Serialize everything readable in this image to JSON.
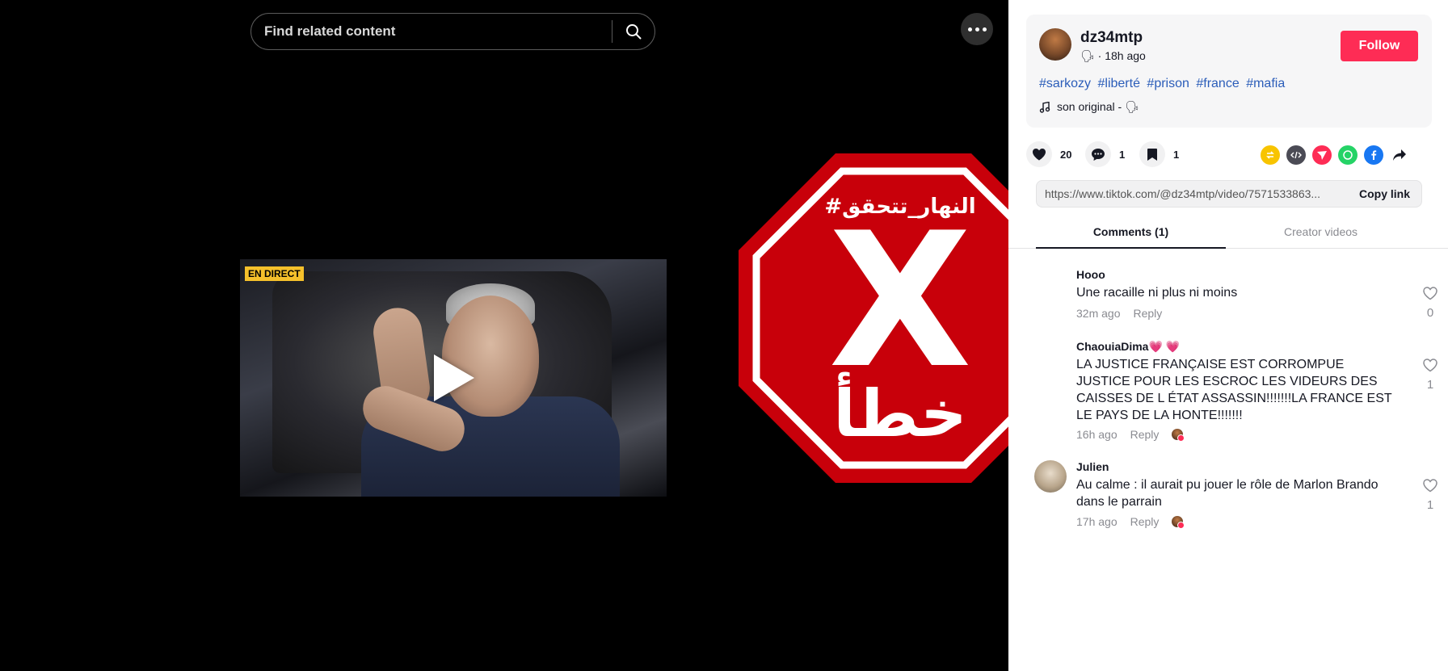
{
  "search": {
    "placeholder": "Find related content"
  },
  "video": {
    "badge": "EN DIRECT"
  },
  "stamp": {
    "hashtag": "#النهار_تتحقق",
    "mark": "X",
    "verdict": "خطأ",
    "color": "#c8000a"
  },
  "author": {
    "username": "dz34mtp",
    "meta": "🗣 · 18h ago",
    "follow_label": "Follow"
  },
  "tags": [
    "#sarkozy",
    "#liberté",
    "#prison",
    "#france",
    "#mafia"
  ],
  "music": {
    "icon": "music-note-icon",
    "label": "son original - 🗣"
  },
  "actions": {
    "likes": "20",
    "comments": "1",
    "saves": "1"
  },
  "link": {
    "url": "https://www.tiktok.com/@dz34mtp/video/7571533863...",
    "copy_label": "Copy link"
  },
  "tabs": [
    {
      "label": "Comments (1)"
    },
    {
      "label": "Creator videos"
    }
  ],
  "comments": [
    {
      "name": "Hooo",
      "text": "Une racaille ni plus ni moins",
      "time": "32m ago",
      "reply": "Reply",
      "likes": "0"
    },
    {
      "name": "ChaouiaDima💗 💗",
      "text": "LA JUSTICE FRANÇAISE EST CORROMPUE JUSTICE POUR LES ESCROC LES VIDEURS DES CAISSES DE L ÉTAT ASSASSIN!!!!!!!LA FRANCE EST LE PAYS DE LA HONTE!!!!!!!",
      "time": "16h ago",
      "reply": "Reply",
      "likes": "1"
    },
    {
      "name": "Julien",
      "text": "Au calme : il aurait pu jouer le rôle de Marlon Brando dans le parrain",
      "time": "17h ago",
      "reply": "Reply",
      "likes": "1"
    }
  ],
  "colors": {
    "accent": "#fe2c55",
    "tag": "#2b5db9"
  }
}
